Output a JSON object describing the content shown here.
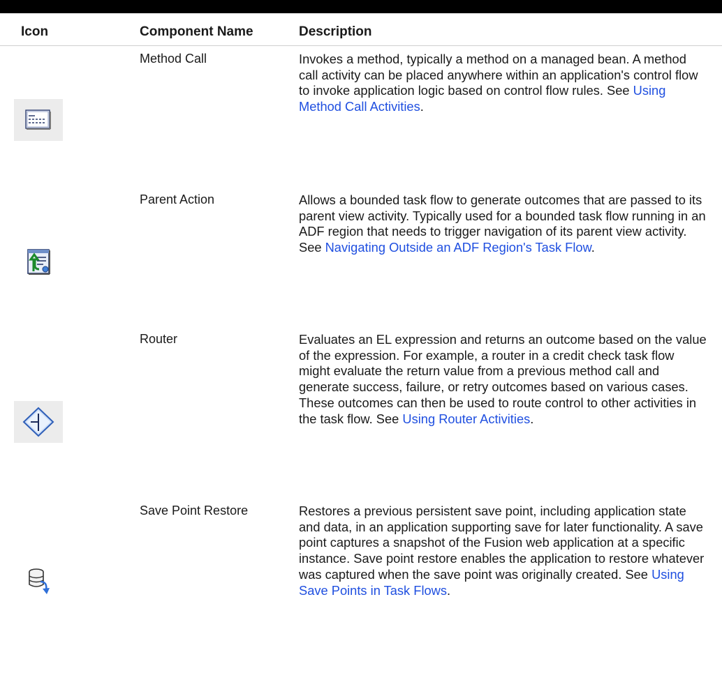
{
  "table": {
    "headers": {
      "icon": "Icon",
      "name": "Component Name",
      "description": "Description"
    },
    "rows": [
      {
        "icon": "method-call-icon",
        "name": "Method Call",
        "desc_before": "Invokes a method, typically a method on a managed bean. A method call activity can be placed anywhere within an application's control flow to invoke application logic based on control flow rules. See ",
        "link": "Using Method Call Activities",
        "desc_after": "."
      },
      {
        "icon": "parent-action-icon",
        "name": "Parent Action",
        "desc_before": "Allows a bounded task flow to generate outcomes that are passed to its parent view activity. Typically used for a bounded task flow running in an ADF region that needs to trigger navigation of its parent view activity. See ",
        "link": "Navigating Outside an ADF Region's Task Flow",
        "desc_after": "."
      },
      {
        "icon": "router-icon",
        "name": "Router",
        "desc_before": "Evaluates an EL expression and returns an outcome based on the value of the expression. For example, a router in a credit check task flow might evaluate the return value from a previous method call and generate success, failure, or retry outcomes based on various cases. These outcomes can then be used to route control to other activities in the task flow. See ",
        "link": "Using Router Activities",
        "desc_after": "."
      },
      {
        "icon": "save-point-restore-icon",
        "name": "Save Point Restore",
        "desc_before": "Restores a previous persistent save point, including application state and data, in an application supporting save for later functionality. A save point captures a snapshot of the Fusion web application at a specific instance. Save point restore enables the application to restore whatever was captured when the save point was originally created. See ",
        "link": "Using Save Points in Task Flows",
        "desc_after": "."
      }
    ]
  }
}
